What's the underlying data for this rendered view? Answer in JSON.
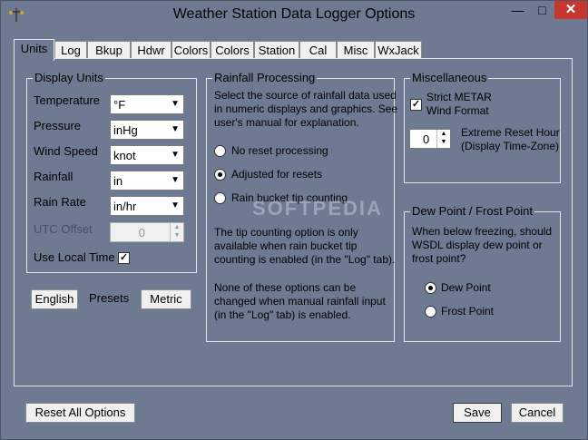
{
  "window": {
    "title": "Weather Station Data Logger Options",
    "close": "✕",
    "minimize": "—",
    "maximize": "□"
  },
  "tabs": [
    "Units",
    "Log",
    "Bkup",
    "Hdwr",
    "Colors",
    "Colors",
    "Station",
    "Cal",
    "Misc",
    "WxJack"
  ],
  "display_units": {
    "legend": "Display Units",
    "temperature": {
      "label": "Temperature",
      "value": "°F"
    },
    "pressure": {
      "label": "Pressure",
      "value": "inHg"
    },
    "wind_speed": {
      "label": "Wind Speed",
      "value": "knot"
    },
    "rainfall": {
      "label": "Rainfall",
      "value": "in"
    },
    "rain_rate": {
      "label": "Rain Rate",
      "value": "in/hr"
    },
    "utc_offset": {
      "label": "UTC Offset",
      "value": "0"
    },
    "use_local_time": {
      "label": "Use Local Time",
      "checked": true
    }
  },
  "presets": {
    "english": "English",
    "label": "Presets",
    "metric": "Metric"
  },
  "rainfall_processing": {
    "legend": "Rainfall Processing",
    "intro": [
      "Select the source of rainfall data used",
      "in numeric displays and graphics. See",
      "user's manual for explanation."
    ],
    "options": [
      "No reset processing",
      "Adjusted for resets",
      "Rain bucket tip counting"
    ],
    "selected": 1,
    "note1": [
      "The tip counting option is only",
      "available when rain bucket tip",
      "counting is enabled (in the \"Log\" tab)."
    ],
    "note2": [
      "None of these options can be",
      "changed when manual rainfall input",
      "(in the \"Log\" tab) is enabled."
    ]
  },
  "miscellaneous": {
    "legend": "Miscellaneous",
    "strict_metar": [
      "Strict METAR",
      "Wind Format"
    ],
    "strict_metar_checked": true,
    "extreme_reset_value": "0",
    "extreme_reset_label": [
      "Extreme Reset Hour",
      "(Display Time-Zone)"
    ]
  },
  "dew_frost": {
    "legend": "Dew Point / Frost Point",
    "question": [
      "When below freezing, should",
      "WSDL display dew point or",
      "frost point?"
    ],
    "options": [
      "Dew Point",
      "Frost Point"
    ],
    "selected": 0
  },
  "footer": {
    "reset_all": "Reset All Options",
    "save": "Save",
    "cancel": "Cancel"
  },
  "watermark": "SOFTPEDIA",
  "colors": {
    "window_bg": "#6e7a91",
    "close_button": "#c7372f",
    "border_light": "#e6e6e6"
  }
}
